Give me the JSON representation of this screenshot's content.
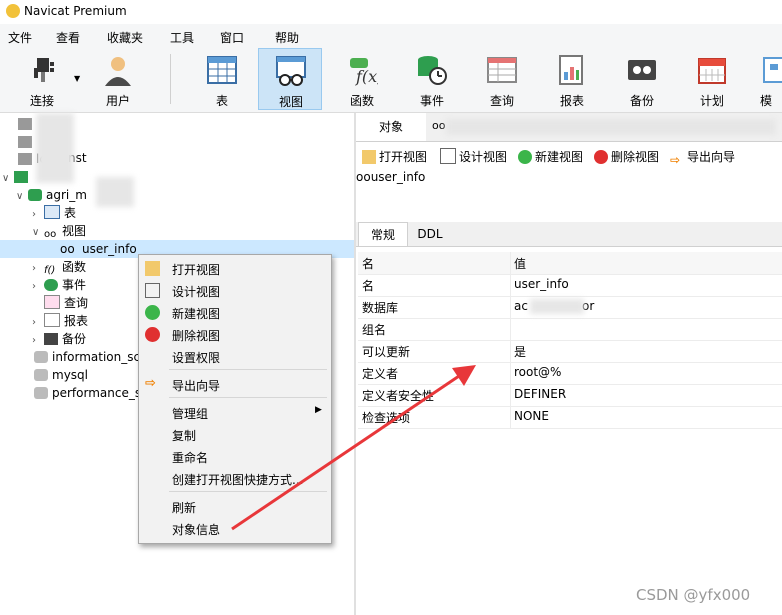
{
  "window": {
    "title": "Navicat Premium"
  },
  "menu": [
    "文件",
    "查看",
    "收藏夹",
    "工具",
    "窗口",
    "帮助"
  ],
  "toolbar": [
    {
      "label": "连接",
      "icon": "plug-icon"
    },
    {
      "label": "用户",
      "icon": "user-icon"
    },
    {
      "label": "表",
      "icon": "table-icon"
    },
    {
      "label": "视图",
      "icon": "view-glasses-icon",
      "active": true
    },
    {
      "label": "函数",
      "icon": "function-icon"
    },
    {
      "label": "事件",
      "icon": "event-clock-icon"
    },
    {
      "label": "查询",
      "icon": "query-icon"
    },
    {
      "label": "报表",
      "icon": "report-icon"
    },
    {
      "label": "备份",
      "icon": "backup-icon"
    },
    {
      "label": "计划",
      "icon": "calendar-icon"
    },
    {
      "label": "模",
      "icon": "model-icon"
    }
  ],
  "tree": {
    "connection_partial": "lc",
    "connection_suffix": "nst",
    "database": "agri_m",
    "tables": "表",
    "views": "视图",
    "selected_view": "user_info",
    "functions": "函数",
    "events": "事件",
    "queries": "查询",
    "reports": "报表",
    "backups": "备份",
    "dbs": [
      "information_sc",
      "mysql",
      "performance_s"
    ]
  },
  "right": {
    "tab": "对象",
    "buttons": [
      "打开视图",
      "设计视图",
      "新建视图",
      "删除视图",
      "导出向导"
    ],
    "view_name": "user_info",
    "subtabs": [
      "常规",
      "DDL"
    ],
    "props": [
      {
        "k": "名",
        "v": "值"
      },
      {
        "k": "名",
        "v": "user_info"
      },
      {
        "k": "数据库",
        "v": "ac",
        "v_tail": "or"
      },
      {
        "k": "组名",
        "v": ""
      },
      {
        "k": "可以更新",
        "v": "是"
      },
      {
        "k": "定义者",
        "v": "root@%"
      },
      {
        "k": "定义者安全性",
        "v": "DEFINER"
      },
      {
        "k": "检查选项",
        "v": "NONE"
      }
    ]
  },
  "context_menu": {
    "items": [
      "打开视图",
      "设计视图",
      "新建视图",
      "删除视图",
      "设置权限",
      "导出向导",
      "管理组",
      "复制",
      "重命名",
      "创建打开视图快捷方式...",
      "刷新",
      "对象信息"
    ]
  },
  "watermark": "CSDN @yfx000",
  "colors": {
    "accent": "#cce4f7",
    "arrow": "#e8373a",
    "selection": "#cce8ff"
  }
}
